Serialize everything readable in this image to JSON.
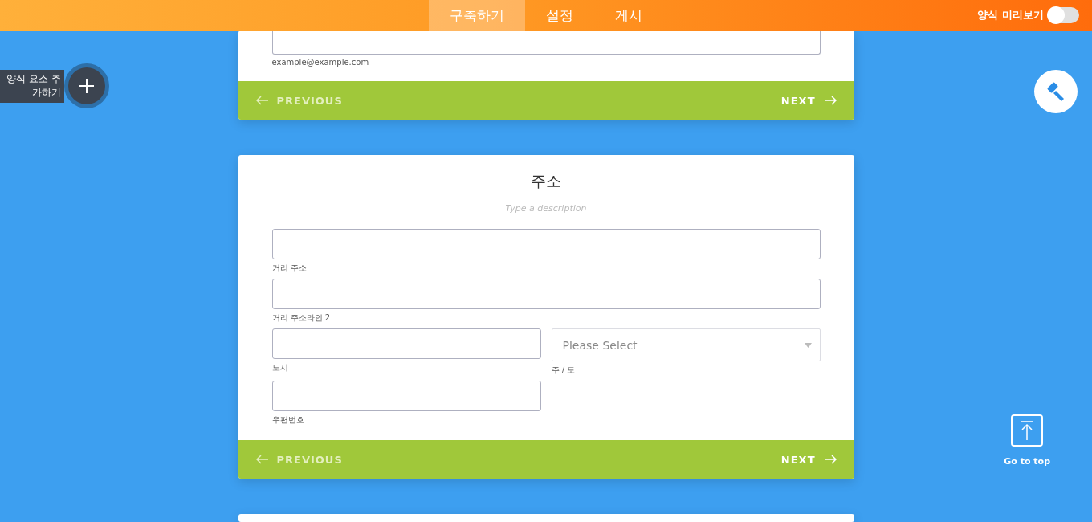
{
  "top_bar": {
    "tabs": [
      {
        "label": "구축하기",
        "selected": true
      },
      {
        "label": "설정",
        "selected": false
      },
      {
        "label": "게시",
        "selected": false
      }
    ],
    "preview_toggle": {
      "label": "양식 미리보기",
      "on": false
    }
  },
  "add_element": {
    "label": "양식 요소 추가하기"
  },
  "go_to_top": {
    "label": "Go to top"
  },
  "cards": [
    {
      "rows": [
        [
          {
            "kind": "input",
            "sublabel": "example@example.com"
          }
        ]
      ],
      "previous": "PREVIOUS",
      "next": "NEXT"
    },
    {
      "title": "주소",
      "description": "Type a description",
      "rows": [
        [
          {
            "kind": "input",
            "sublabel": "거리 주소"
          }
        ],
        [
          {
            "kind": "input",
            "sublabel": "거리 주소라인 2"
          }
        ],
        [
          {
            "kind": "input",
            "sublabel": "도시"
          },
          {
            "kind": "select",
            "placeholder": "Please Select",
            "sublabel": "주 / 도"
          }
        ],
        [
          {
            "kind": "input",
            "sublabel": "우편번호"
          },
          {
            "kind": "empty"
          }
        ]
      ],
      "previous": "PREVIOUS",
      "next": "NEXT"
    }
  ]
}
